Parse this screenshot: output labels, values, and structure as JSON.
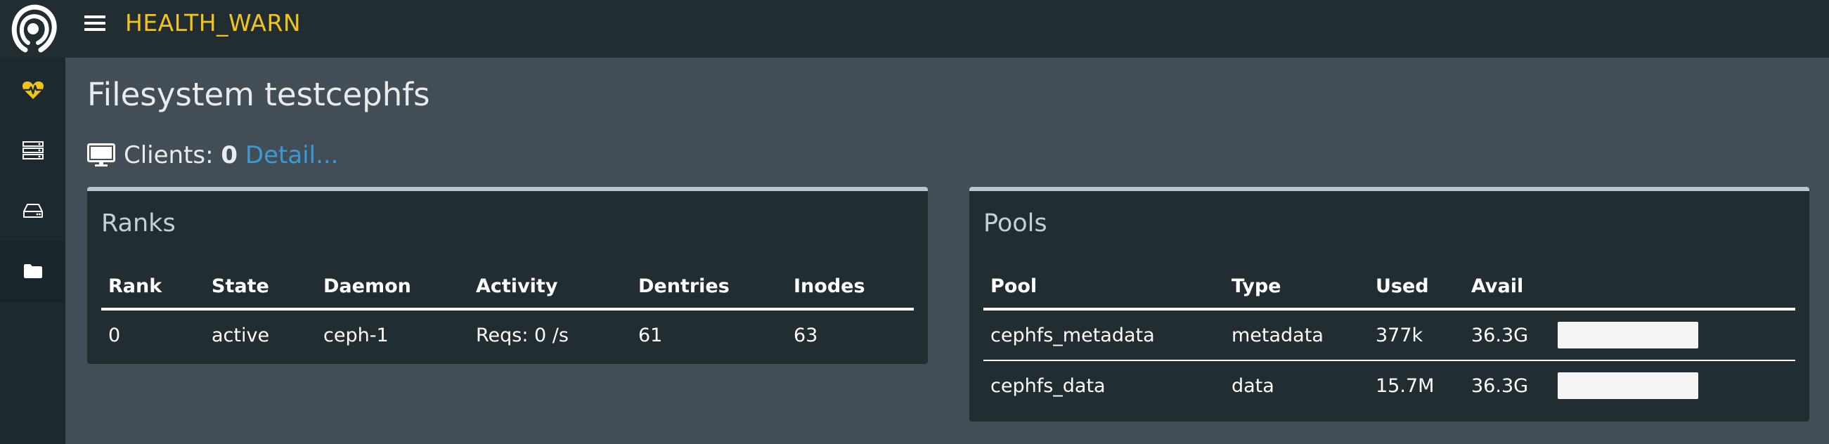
{
  "topbar": {
    "status": "HEALTH_WARN",
    "status_color": "#f0c419",
    "menu_icon": "hamburger-menu-icon",
    "logo_icon": "ceph-logo"
  },
  "sidebar": {
    "items": [
      {
        "icon": "heartbeat-icon",
        "active": false
      },
      {
        "icon": "servers-icon",
        "active": false
      },
      {
        "icon": "hard-drive-icon",
        "active": false
      },
      {
        "icon": "folder-icon",
        "active": true
      }
    ]
  },
  "page": {
    "title": "Filesystem testcephfs",
    "clients_label": "Clients:",
    "clients_count": "0",
    "detail_link": "Detail..."
  },
  "ranks": {
    "title": "Ranks",
    "columns": [
      "Rank",
      "State",
      "Daemon",
      "Activity",
      "Dentries",
      "Inodes"
    ],
    "rows": [
      [
        "0",
        "active",
        "ceph-1",
        "Reqs: 0 /s",
        "61",
        "63"
      ]
    ]
  },
  "pools": {
    "title": "Pools",
    "columns": [
      "Pool",
      "Type",
      "Used",
      "Avail",
      ""
    ],
    "rows": [
      {
        "pool": "cephfs_metadata",
        "type": "metadata",
        "used": "377k",
        "avail": "36.3G",
        "usage_fraction": 0.0
      },
      {
        "pool": "cephfs_data",
        "type": "data",
        "used": "15.7M",
        "avail": "36.3G",
        "usage_fraction": 0.0
      }
    ]
  },
  "colors": {
    "accent_link": "#3b9ad6",
    "warn": "#f0c419",
    "panel_bg": "#222d32",
    "page_bg": "#424d55"
  }
}
